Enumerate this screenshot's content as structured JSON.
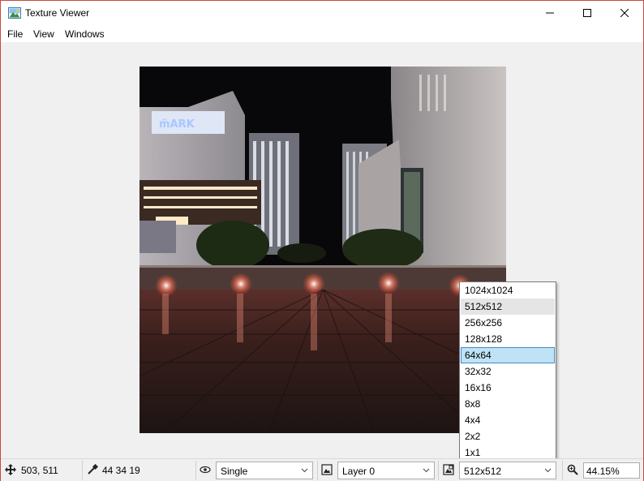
{
  "window": {
    "title": "Texture Viewer"
  },
  "caption_buttons": {
    "minimize": "minimize-icon",
    "maximize": "maximize-icon",
    "close": "close-icon"
  },
  "menu": [
    "File",
    "View",
    "Windows"
  ],
  "mip_dropdown": {
    "items": [
      "1024x1024",
      "512x512",
      "256x256",
      "128x128",
      "64x64",
      "32x32",
      "16x16",
      "8x8",
      "4x4",
      "2x2",
      "1x1"
    ],
    "hovered": "512x512",
    "highlighted": "64x64"
  },
  "statusbar": {
    "cursor_position": "503, 511",
    "pixel_value": "44 34 19",
    "channel_mode": "Single",
    "layer": "Layer 0",
    "mip_level": "512x512",
    "zoom": "44.15%"
  },
  "colors": {
    "window_border": "#c84b3c",
    "selection_fill": "#bfe3f5",
    "selection_border": "#3d8fc6"
  }
}
